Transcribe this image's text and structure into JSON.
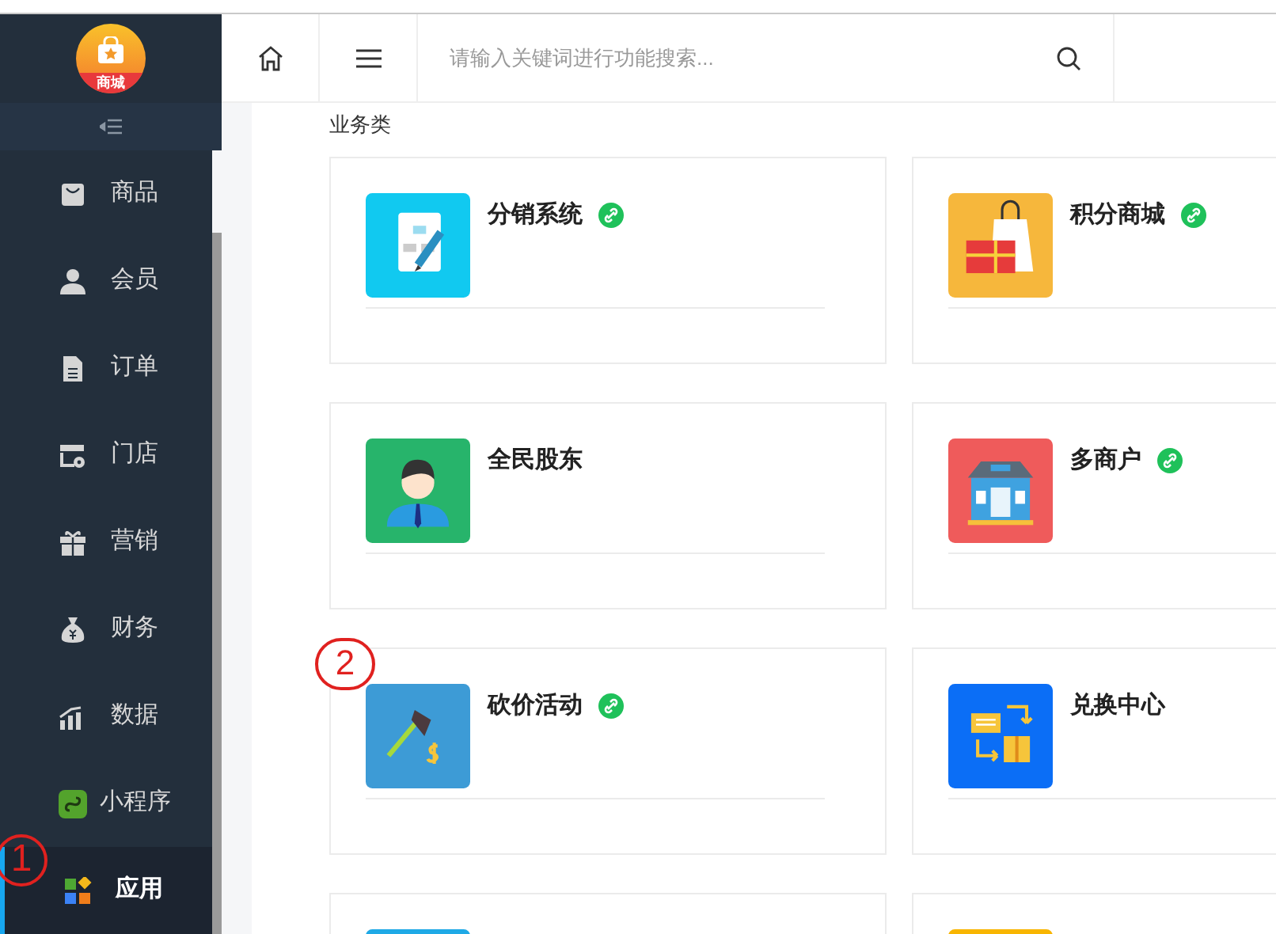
{
  "logo": {
    "text": "商城"
  },
  "sidebar": {
    "items": [
      {
        "label": "商品",
        "kind": "bag",
        "selected": false
      },
      {
        "label": "会员",
        "kind": "user",
        "selected": false
      },
      {
        "label": "订单",
        "kind": "doc",
        "selected": false
      },
      {
        "label": "门店",
        "kind": "store",
        "selected": false
      },
      {
        "label": "营销",
        "kind": "gift",
        "selected": false
      },
      {
        "label": "财务",
        "kind": "money",
        "selected": false
      },
      {
        "label": "数据",
        "kind": "chart",
        "selected": false
      },
      {
        "label": "小程序",
        "kind": "mini",
        "selected": false
      },
      {
        "label": "应用",
        "kind": "apps",
        "selected": true
      }
    ]
  },
  "search": {
    "placeholder": "请输入关键词进行功能搜索..."
  },
  "section": {
    "title": "业务类"
  },
  "apps": [
    {
      "title": "分销系统",
      "kind": "flow",
      "color": "#11c9f0",
      "linked": true
    },
    {
      "title": "积分商城",
      "kind": "shop-bag",
      "color": "#f6b73c",
      "linked": true
    },
    {
      "title": "全民股东",
      "kind": "person",
      "color": "#27b46b",
      "linked": false
    },
    {
      "title": "多商户",
      "kind": "store",
      "color": "#ef5b5b",
      "linked": true
    },
    {
      "title": "砍价活动",
      "kind": "axe",
      "color": "#3d9bd6",
      "linked": true
    },
    {
      "title": "兑换中心",
      "kind": "exchange",
      "color": "#0b6ef6",
      "linked": false
    },
    {
      "kind": "blank",
      "color": "#1fa9e6"
    },
    {
      "kind": "blank",
      "color": "#f8b500"
    }
  ],
  "annotations": [
    {
      "label": "1"
    },
    {
      "label": "2"
    }
  ]
}
